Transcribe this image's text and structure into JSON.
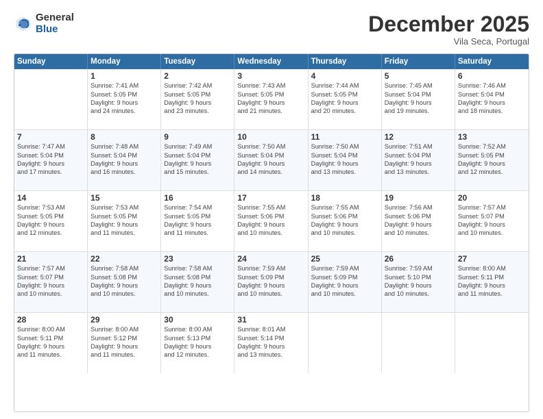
{
  "logo": {
    "general": "General",
    "blue": "Blue"
  },
  "header": {
    "month": "December 2025",
    "location": "Vila Seca, Portugal"
  },
  "weekdays": [
    "Sunday",
    "Monday",
    "Tuesday",
    "Wednesday",
    "Thursday",
    "Friday",
    "Saturday"
  ],
  "rows": [
    [
      {
        "day": "",
        "info": ""
      },
      {
        "day": "1",
        "info": "Sunrise: 7:41 AM\nSunset: 5:05 PM\nDaylight: 9 hours\nand 24 minutes."
      },
      {
        "day": "2",
        "info": "Sunrise: 7:42 AM\nSunset: 5:05 PM\nDaylight: 9 hours\nand 23 minutes."
      },
      {
        "day": "3",
        "info": "Sunrise: 7:43 AM\nSunset: 5:05 PM\nDaylight: 9 hours\nand 21 minutes."
      },
      {
        "day": "4",
        "info": "Sunrise: 7:44 AM\nSunset: 5:05 PM\nDaylight: 9 hours\nand 20 minutes."
      },
      {
        "day": "5",
        "info": "Sunrise: 7:45 AM\nSunset: 5:04 PM\nDaylight: 9 hours\nand 19 minutes."
      },
      {
        "day": "6",
        "info": "Sunrise: 7:46 AM\nSunset: 5:04 PM\nDaylight: 9 hours\nand 18 minutes."
      }
    ],
    [
      {
        "day": "7",
        "info": "Sunrise: 7:47 AM\nSunset: 5:04 PM\nDaylight: 9 hours\nand 17 minutes."
      },
      {
        "day": "8",
        "info": "Sunrise: 7:48 AM\nSunset: 5:04 PM\nDaylight: 9 hours\nand 16 minutes."
      },
      {
        "day": "9",
        "info": "Sunrise: 7:49 AM\nSunset: 5:04 PM\nDaylight: 9 hours\nand 15 minutes."
      },
      {
        "day": "10",
        "info": "Sunrise: 7:50 AM\nSunset: 5:04 PM\nDaylight: 9 hours\nand 14 minutes."
      },
      {
        "day": "11",
        "info": "Sunrise: 7:50 AM\nSunset: 5:04 PM\nDaylight: 9 hours\nand 13 minutes."
      },
      {
        "day": "12",
        "info": "Sunrise: 7:51 AM\nSunset: 5:04 PM\nDaylight: 9 hours\nand 13 minutes."
      },
      {
        "day": "13",
        "info": "Sunrise: 7:52 AM\nSunset: 5:05 PM\nDaylight: 9 hours\nand 12 minutes."
      }
    ],
    [
      {
        "day": "14",
        "info": "Sunrise: 7:53 AM\nSunset: 5:05 PM\nDaylight: 9 hours\nand 12 minutes."
      },
      {
        "day": "15",
        "info": "Sunrise: 7:53 AM\nSunset: 5:05 PM\nDaylight: 9 hours\nand 11 minutes."
      },
      {
        "day": "16",
        "info": "Sunrise: 7:54 AM\nSunset: 5:05 PM\nDaylight: 9 hours\nand 11 minutes."
      },
      {
        "day": "17",
        "info": "Sunrise: 7:55 AM\nSunset: 5:06 PM\nDaylight: 9 hours\nand 10 minutes."
      },
      {
        "day": "18",
        "info": "Sunrise: 7:55 AM\nSunset: 5:06 PM\nDaylight: 9 hours\nand 10 minutes."
      },
      {
        "day": "19",
        "info": "Sunrise: 7:56 AM\nSunset: 5:06 PM\nDaylight: 9 hours\nand 10 minutes."
      },
      {
        "day": "20",
        "info": "Sunrise: 7:57 AM\nSunset: 5:07 PM\nDaylight: 9 hours\nand 10 minutes."
      }
    ],
    [
      {
        "day": "21",
        "info": "Sunrise: 7:57 AM\nSunset: 5:07 PM\nDaylight: 9 hours\nand 10 minutes."
      },
      {
        "day": "22",
        "info": "Sunrise: 7:58 AM\nSunset: 5:08 PM\nDaylight: 9 hours\nand 10 minutes."
      },
      {
        "day": "23",
        "info": "Sunrise: 7:58 AM\nSunset: 5:08 PM\nDaylight: 9 hours\nand 10 minutes."
      },
      {
        "day": "24",
        "info": "Sunrise: 7:59 AM\nSunset: 5:09 PM\nDaylight: 9 hours\nand 10 minutes."
      },
      {
        "day": "25",
        "info": "Sunrise: 7:59 AM\nSunset: 5:09 PM\nDaylight: 9 hours\nand 10 minutes."
      },
      {
        "day": "26",
        "info": "Sunrise: 7:59 AM\nSunset: 5:10 PM\nDaylight: 9 hours\nand 10 minutes."
      },
      {
        "day": "27",
        "info": "Sunrise: 8:00 AM\nSunset: 5:11 PM\nDaylight: 9 hours\nand 11 minutes."
      }
    ],
    [
      {
        "day": "28",
        "info": "Sunrise: 8:00 AM\nSunset: 5:11 PM\nDaylight: 9 hours\nand 11 minutes."
      },
      {
        "day": "29",
        "info": "Sunrise: 8:00 AM\nSunset: 5:12 PM\nDaylight: 9 hours\nand 11 minutes."
      },
      {
        "day": "30",
        "info": "Sunrise: 8:00 AM\nSunset: 5:13 PM\nDaylight: 9 hours\nand 12 minutes."
      },
      {
        "day": "31",
        "info": "Sunrise: 8:01 AM\nSunset: 5:14 PM\nDaylight: 9 hours\nand 13 minutes."
      },
      {
        "day": "",
        "info": ""
      },
      {
        "day": "",
        "info": ""
      },
      {
        "day": "",
        "info": ""
      }
    ]
  ]
}
